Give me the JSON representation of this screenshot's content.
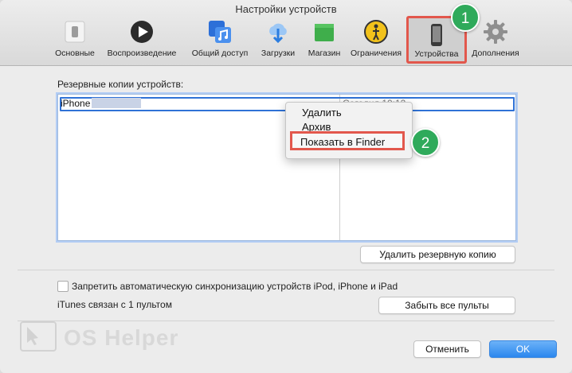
{
  "window": {
    "title": "Настройки устройств"
  },
  "toolbar": {
    "items": [
      {
        "label": "Основные",
        "icon": "phone-switch-icon"
      },
      {
        "label": "Воспроизведение",
        "icon": "play-icon"
      },
      {
        "label": "Общий доступ",
        "icon": "music-share-icon"
      },
      {
        "label": "Загрузки",
        "icon": "download-cloud-icon"
      },
      {
        "label": "Магазин",
        "icon": "store-bag-icon"
      },
      {
        "label": "Ограничения",
        "icon": "restrictions-icon"
      },
      {
        "label": "Устройства",
        "icon": "iphone-icon"
      },
      {
        "label": "Дополнения",
        "icon": "gear-icon"
      }
    ],
    "selected": "Устройства"
  },
  "backups": {
    "label": "Резервные копии устройств:",
    "row_name": "iPhone",
    "row_date": "Сегодня 10:12"
  },
  "context_menu": {
    "items": [
      "Удалить",
      "Архив",
      "Показать в Finder"
    ]
  },
  "badges": {
    "first": "1",
    "second": "2"
  },
  "buttons": {
    "delete_backup": "Удалить резервную копию",
    "forget_remotes": "Забыть все пульты",
    "cancel": "Отменить",
    "ok": "OK"
  },
  "options": {
    "prevent_sync": "Запретить автоматическую синхронизацию устройств iPod, iPhone и iPad",
    "remotes_info": "iTunes связан с 1 пультом"
  },
  "watermark": {
    "text": "OS Helper"
  },
  "colors": {
    "accent_red": "#e2574c",
    "badge_green": "#2faa5b",
    "ok_blue": "#2b87ee"
  }
}
